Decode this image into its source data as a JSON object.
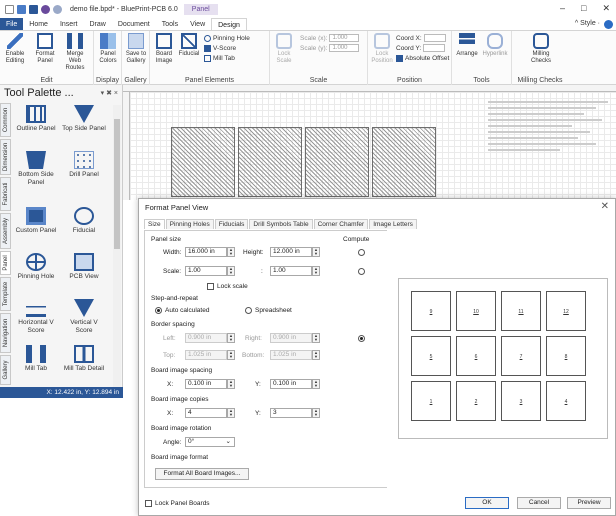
{
  "window": {
    "title": "demo file.bpd* - BluePrint-PCB 6.0",
    "context_tab": "Panel",
    "minimize": "–",
    "maximize": "□",
    "close": "✕"
  },
  "ribbon_tabs": [
    "File",
    "Home",
    "Insert",
    "Draw",
    "Document",
    "Tools",
    "View",
    "Design"
  ],
  "style_label": "^ Style ·",
  "ribbon": {
    "edit_group": {
      "label": "Edit",
      "buttons": [
        "Enable Editing",
        "Format Panel",
        "Merge Web Routes"
      ]
    },
    "display_group": {
      "label": "Display",
      "buttons": [
        "Panel Colors"
      ]
    },
    "gallery_group": {
      "label": "Gallery",
      "buttons": [
        "Save to Gallery"
      ]
    },
    "elements_group": {
      "label": "Panel Elements",
      "buttons": [
        "Board Image",
        "Fiducial"
      ],
      "small": [
        "Pinning Hole",
        "V-Score",
        "Mill Tab"
      ]
    },
    "scale_group": {
      "label": "Scale",
      "lock": "Lock Scale",
      "scale_x_label": "Scale (x):",
      "scale_x": "1.000",
      "scale_y_label": "Scale (y):",
      "scale_y": "1.000"
    },
    "position_group": {
      "label": "Position",
      "lock": "Lock Position",
      "coord_x_label": "Coord X:",
      "coord_y_label": "Coord Y:",
      "absolute_offset": "Absolute Offset"
    },
    "tools_group": {
      "label": "Tools",
      "buttons": [
        "Arrange",
        "Hyperlink"
      ]
    },
    "milling_group": {
      "label": "Milling Checks",
      "buttons": [
        "Milling Checks"
      ]
    }
  },
  "palette": {
    "title": "Tool Palette ...",
    "controls": "▾ ✖ ×",
    "vertical_tabs": [
      "Common",
      "Dimension",
      "Fabricati",
      "Assembly",
      "Panel",
      "Template",
      "Navigation",
      "Gallery"
    ],
    "tools": [
      "Outline Panel",
      "Top Side Panel",
      "Bottom Side Panel",
      "Drill Panel",
      "Custom Panel",
      "Fiducial",
      "Pinning Hole",
      "PCB View",
      "Horizontal V Score",
      "Vertical V Score",
      "Mill Tab",
      "Mill Tab Detail"
    ]
  },
  "status": {
    "coords": "X: 12.422 in, Y: 12.894 in"
  },
  "dialog": {
    "title": "Format Panel View",
    "close": "✕",
    "tabs": [
      "Size",
      "Pinning Holes",
      "Fiducials",
      "Drill Symbols Table",
      "Corner Chamfer",
      "Image Letters"
    ],
    "panel_size": {
      "header": "Panel size",
      "compute": "Compute",
      "width_label": "Width:",
      "width": "16.000 in",
      "height_label": "Height:",
      "height": "12.000 in",
      "scale_label": "Scale:",
      "scale_x": "1.00",
      "scale_y": "1.00",
      "colon": ":",
      "lock_scale": "Lock scale"
    },
    "step_repeat": {
      "header": "Step-and-repeat",
      "auto": "Auto calculated",
      "spreadsheet": "Spreadsheet"
    },
    "border_spacing": {
      "header": "Border spacing",
      "left_label": "Left:",
      "left": "0.900 in",
      "right_label": "Right:",
      "right": "0.900 in",
      "top_label": "Top:",
      "top": "1.025 in",
      "bottom_label": "Bottom:",
      "bottom": "1.025 in"
    },
    "image_spacing": {
      "header": "Board image spacing",
      "x_label": "X:",
      "x": "0.100 in",
      "y_label": "Y:",
      "y": "0.100 in"
    },
    "image_copies": {
      "header": "Board image copies",
      "x_label": "X:",
      "x": "4",
      "y_label": "Y:",
      "y": "3"
    },
    "rotation": {
      "header": "Board image rotation",
      "angle_label": "Angle:",
      "angle": "0°"
    },
    "image_format": {
      "header": "Board image format",
      "button": "Format All Board Images..."
    },
    "preview_cells": [
      "9",
      "10",
      "11",
      "12",
      "5",
      "6",
      "7",
      "8",
      "1",
      "2",
      "3",
      "4"
    ],
    "lock_panel_boards": "Lock Panel Boards",
    "ok": "OK",
    "cancel": "Cancel",
    "preview": "Preview"
  },
  "colors": {
    "accent": "#2b5797",
    "context": "#6a4a9c"
  }
}
